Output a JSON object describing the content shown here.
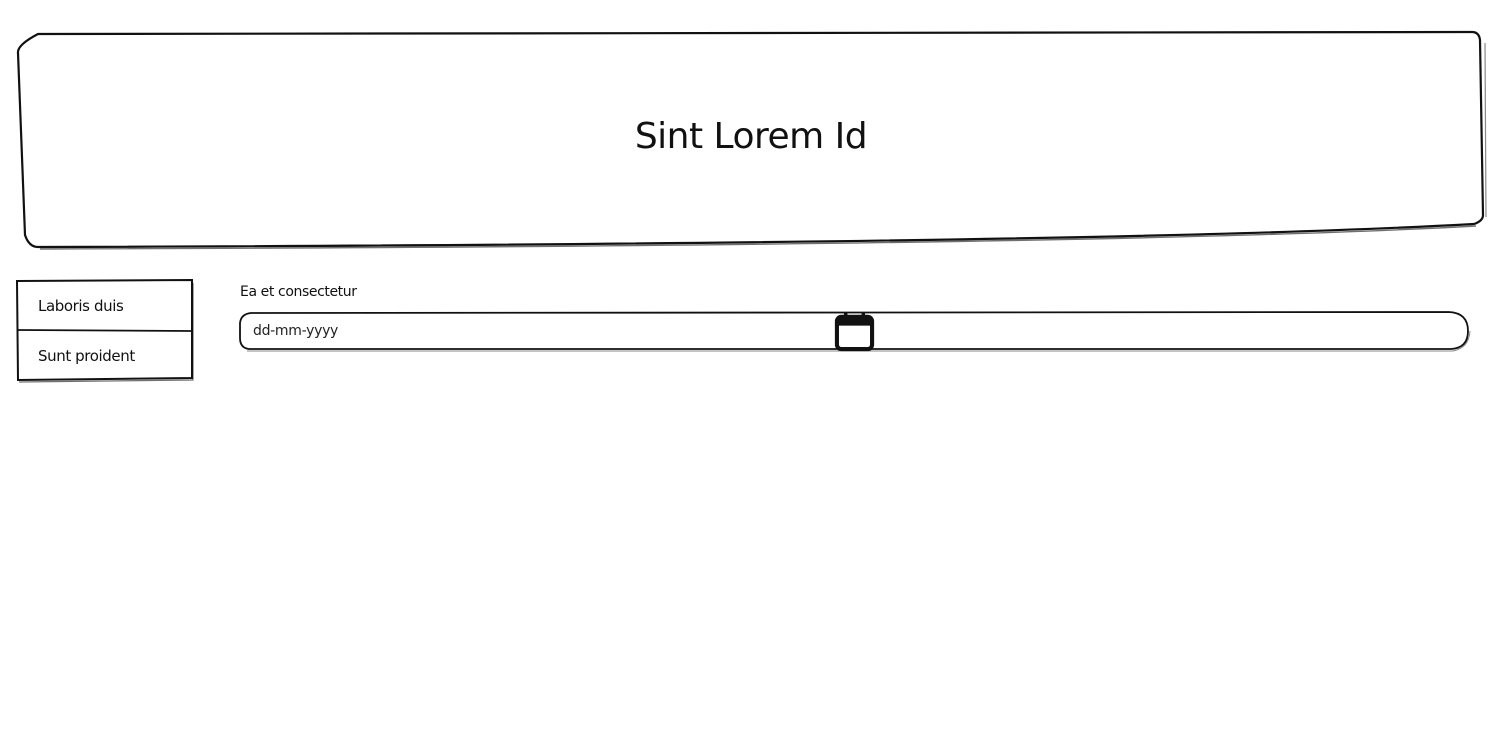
{
  "header": {
    "title": "Sint Lorem Id"
  },
  "sidebar": {
    "items": [
      {
        "label": "Laboris duis"
      },
      {
        "label": "Sunt proident"
      }
    ]
  },
  "form": {
    "date_field": {
      "label": "Ea et consectetur",
      "placeholder": "dd-mm-yyyy",
      "icon": "calendar-icon"
    }
  },
  "colors": {
    "stroke": "#111111",
    "background": "#ffffff"
  }
}
